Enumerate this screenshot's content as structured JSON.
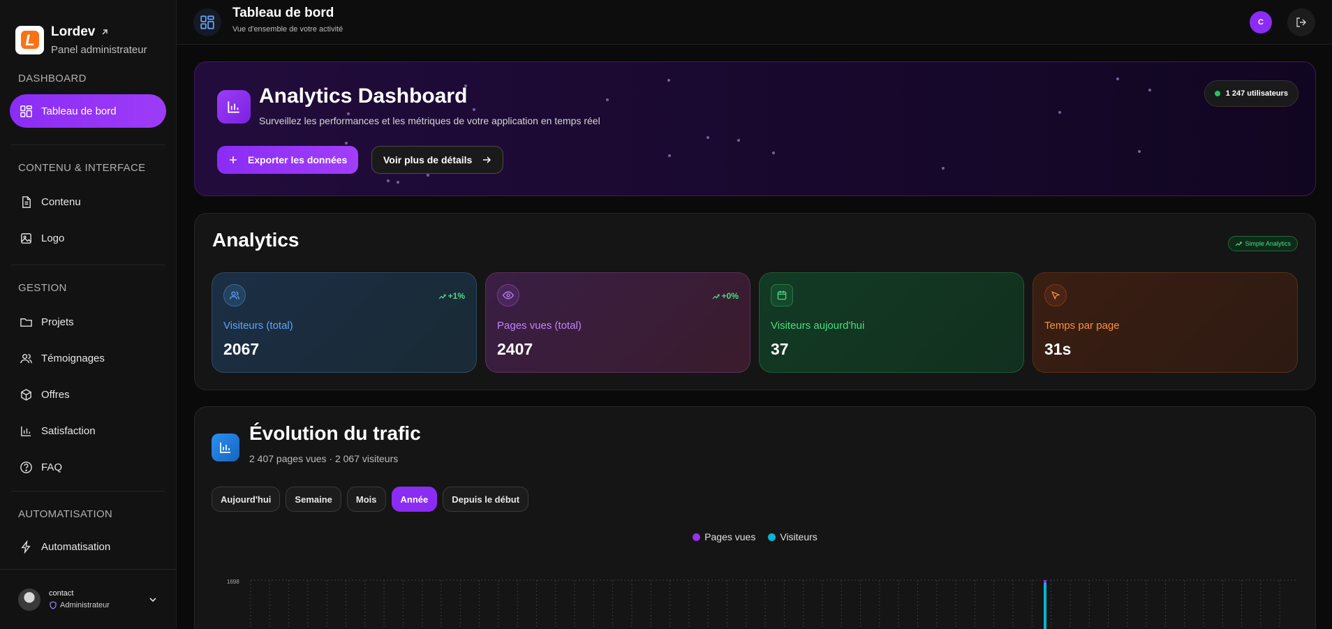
{
  "brand": {
    "name": "Lordev",
    "subtitle": "Panel administrateur",
    "logo_letter": "L"
  },
  "sidebar": {
    "sections": [
      {
        "title": "DASHBOARD"
      },
      {
        "title": "CONTENU & INTERFACE"
      },
      {
        "title": "GESTION"
      },
      {
        "title": "AUTOMATISATION"
      }
    ],
    "items": [
      {
        "label": "Tableau de bord",
        "icon": "grid-icon",
        "active": true
      },
      {
        "label": "Contenu",
        "icon": "document-icon"
      },
      {
        "label": "Logo",
        "icon": "image-icon"
      },
      {
        "label": "Projets",
        "icon": "folder-icon"
      },
      {
        "label": "Témoignages",
        "icon": "users-icon"
      },
      {
        "label": "Offres",
        "icon": "box-icon"
      },
      {
        "label": "Satisfaction",
        "icon": "bar-chart-icon"
      },
      {
        "label": "FAQ",
        "icon": "help-circle-icon"
      },
      {
        "label": "Automatisation",
        "icon": "lightning-icon"
      }
    ],
    "user": {
      "name": "contact",
      "role": "Administrateur"
    }
  },
  "topbar": {
    "title": "Tableau de bord",
    "subtitle": "Vue d'ensemble de votre activité",
    "user_initial": "C"
  },
  "hero": {
    "title": "Analytics Dashboard",
    "subtitle": "Surveillez les performances et les métriques de votre application en temps réel",
    "export_label": "Exporter les données",
    "details_label": "Voir plus de détails",
    "users_badge": "1 247 utilisateurs"
  },
  "analytics": {
    "title": "Analytics",
    "badge": "Simple Analytics",
    "stats": [
      {
        "label": "Visiteurs (total)",
        "value": "2067",
        "trend": "+1%",
        "color": "#60a5fa",
        "icon": "users-icon"
      },
      {
        "label": "Pages vues (total)",
        "value": "2407",
        "trend": "+0%",
        "color": "#c084fc",
        "icon": "eye-icon"
      },
      {
        "label": "Visiteurs aujourd'hui",
        "value": "37",
        "trend": "",
        "color": "#4ade80",
        "icon": "calendar-icon"
      },
      {
        "label": "Temps par page",
        "value": "31s",
        "trend": "",
        "color": "#fb923c",
        "icon": "cursor-icon"
      }
    ]
  },
  "traffic": {
    "title": "Évolution du trafic",
    "subtitle": "2 407 pages vues · 2 067 visiteurs",
    "tabs": [
      "Aujourd'hui",
      "Semaine",
      "Mois",
      "Année",
      "Depuis le début"
    ],
    "active_tab": "Année",
    "legend": [
      {
        "name": "Pages vues",
        "color": "#9333ea"
      },
      {
        "name": "Visiteurs",
        "color": "#06b6d4"
      }
    ],
    "y_max_label": "1698"
  },
  "chart_data": {
    "type": "bar",
    "series": [
      {
        "name": "Pages vues",
        "color": "#9333ea"
      },
      {
        "name": "Visiteurs",
        "color": "#06b6d4"
      }
    ],
    "ylim": [
      0,
      1698
    ],
    "grid": true,
    "legend_position": "top-center"
  }
}
